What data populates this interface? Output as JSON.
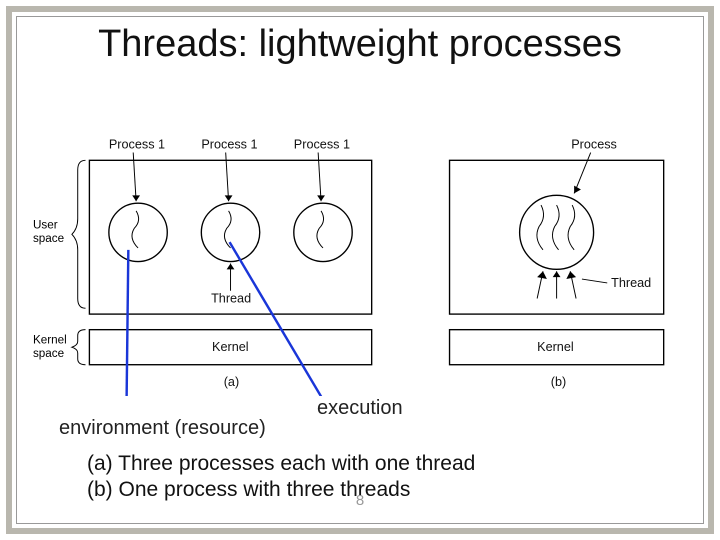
{
  "title": "Threads: lightweight processes",
  "labels": {
    "process1_a": "Process 1",
    "process1_b": "Process 1",
    "process1_c": "Process 1",
    "process_right": "Process",
    "user_space": "User\nspace",
    "kernel_space": "Kernel\nspace",
    "thread_left": "Thread",
    "thread_right": "Thread",
    "kernel_a": "Kernel",
    "kernel_b": "Kernel",
    "fig_a": "(a)",
    "fig_b": "(b)"
  },
  "annotations": {
    "environment": "environment (resource)",
    "execution": "execution"
  },
  "captions": {
    "line_a": "(a) Three processes each with one thread",
    "line_b": "(b) One process with three threads"
  },
  "page_number": "8"
}
